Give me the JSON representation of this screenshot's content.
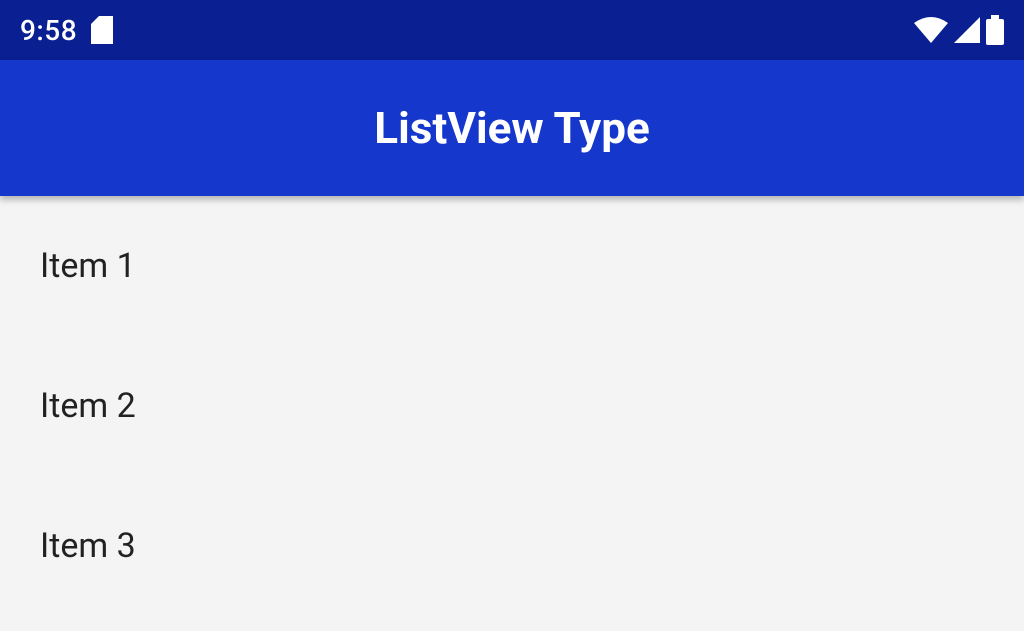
{
  "statusbar": {
    "time": "9:58"
  },
  "appbar": {
    "title": "ListView Type"
  },
  "list": {
    "items": [
      {
        "label": "Item 1"
      },
      {
        "label": "Item 2"
      },
      {
        "label": "Item 3"
      }
    ]
  }
}
